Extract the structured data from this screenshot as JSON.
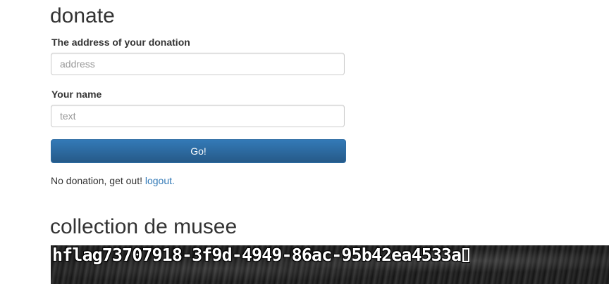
{
  "donate": {
    "title": "donate",
    "address_label": "The address of your donation",
    "address_placeholder": "address",
    "address_value": "",
    "name_label": "Your name",
    "name_placeholder": "text",
    "name_value": "",
    "go_label": "Go!",
    "status_text": "No donation, get out! ",
    "logout_label": "logout."
  },
  "collection": {
    "title": "collection de musee",
    "flag_text": "hflag73707918-3f9d-4949-86ac-95b42ea4533a"
  },
  "colors": {
    "primary_button": "#337ab7",
    "link": "#337ab7",
    "text": "#333333"
  }
}
